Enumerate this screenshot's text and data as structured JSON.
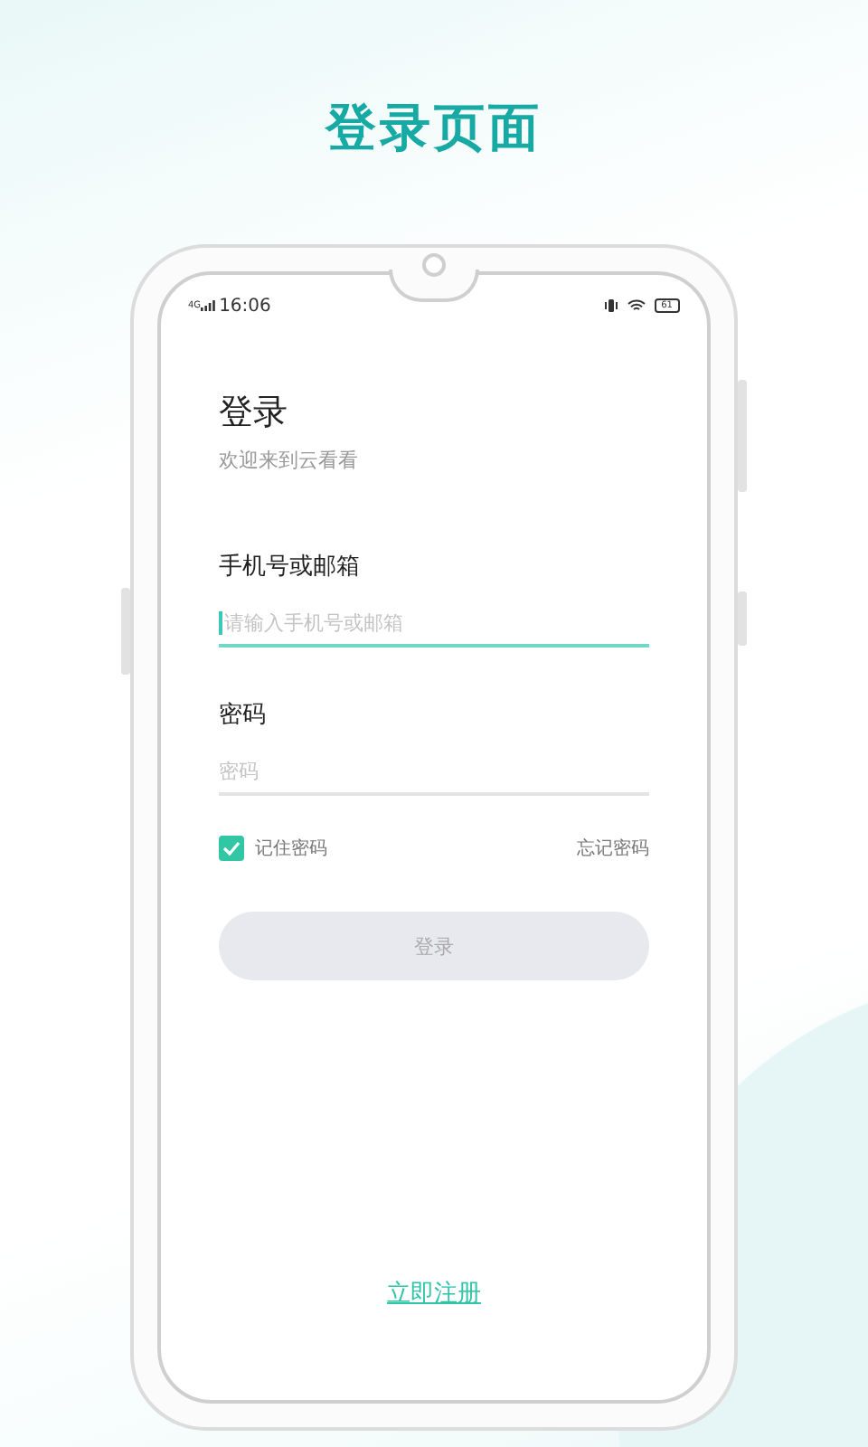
{
  "page_title": "登录页面",
  "status_bar": {
    "network": "4G",
    "time": "16:06",
    "battery": "61"
  },
  "login": {
    "title": "登录",
    "subtitle": "欢迎来到云看看",
    "fields": [
      {
        "label": "手机号或邮箱",
        "placeholder": "请输入手机号或邮箱",
        "focused": true
      },
      {
        "label": "密码",
        "placeholder": "密码",
        "focused": false
      }
    ],
    "remember": {
      "label": "记住密码",
      "checked": true
    },
    "forgot": "忘记密码",
    "submit": {
      "label": "登录",
      "disabled": true
    },
    "register": "立即注册"
  }
}
